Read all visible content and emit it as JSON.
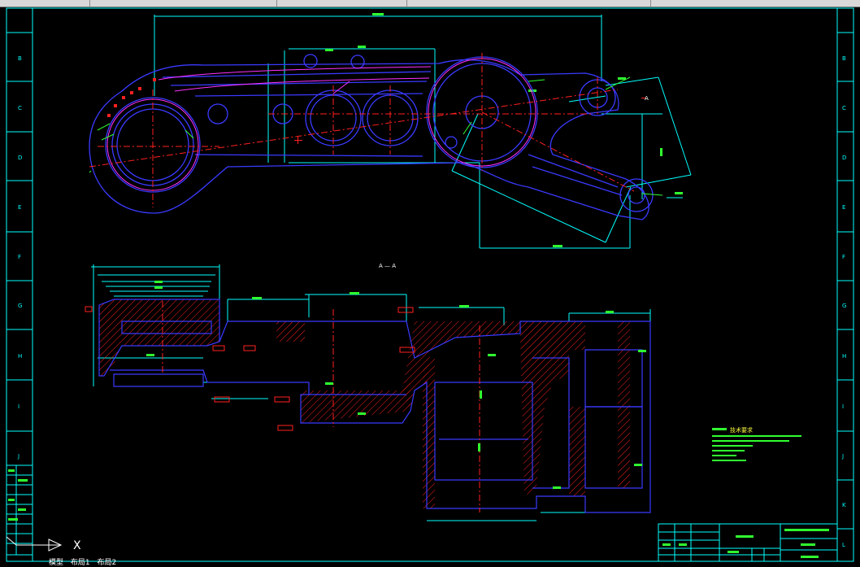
{
  "colors": {
    "background": "#000000",
    "cyan": "#00ffff",
    "blue": "#3a3aff",
    "red": "#ff2020",
    "magenta": "#ff30ff",
    "green": "#30ff30",
    "white": "#ffffff",
    "yellow": "#ffff40"
  },
  "border": {
    "row_letters_left": [
      "B",
      "C",
      "D",
      "E",
      "F",
      "G",
      "H",
      "I",
      "J"
    ],
    "row_letters_right": [
      "B",
      "C",
      "D",
      "E",
      "F",
      "G",
      "H",
      "I",
      "J",
      "K",
      "L"
    ]
  },
  "drawing": {
    "section_label": "A — A",
    "section_marker": "A",
    "technical_requirements_title": "技术要求"
  },
  "ucs": {
    "x_label": "X"
  },
  "tabs": [
    "模型",
    "布局1",
    "布局2"
  ]
}
